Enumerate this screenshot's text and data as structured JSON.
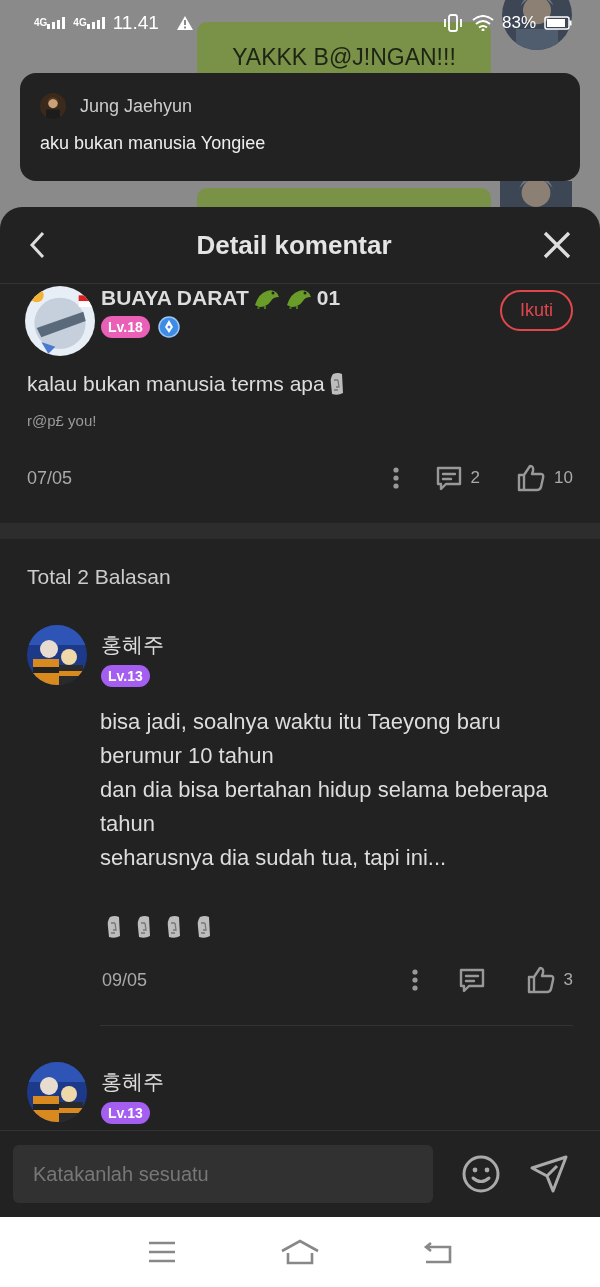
{
  "status_bar": {
    "network": [
      "4G",
      "4G"
    ],
    "time": "11.41",
    "battery": "83%"
  },
  "background_chat": {
    "message": "YAKKK B@J!NGAN!!!"
  },
  "notification": {
    "sender": "Jung Jaehyun",
    "message": "aku bukan manusia Yongiee"
  },
  "sheet": {
    "title": "Detail komentar"
  },
  "comment": {
    "author": "BUAYA DARAT",
    "author_suffix": "01",
    "level": {
      "text": "Lv.18",
      "color": "#e960b6"
    },
    "follow_button": "Ikuti",
    "text": "kalau bukan manusia terms apa",
    "signature": "r@p£ you!",
    "date": "07/05",
    "reply_count": "2",
    "like_count": "10"
  },
  "replies_header": "Total 2 Balasan",
  "replies": [
    {
      "author": "홍혜주",
      "level": {
        "text": "Lv.13",
        "color": "#a45ef0"
      },
      "text": "bisa jadi, soalnya waktu itu Taeyong baru berumur 10 tahun\ndan dia bisa bertahan hidup selama beberapa tahun\nseharusnya dia sudah tua, tapi ini...",
      "date": "09/05",
      "like_count": "3"
    },
    {
      "author": "홍혜주",
      "level": {
        "text": "Lv.13",
        "color": "#a45ef0"
      }
    }
  ],
  "composer": {
    "placeholder": "Katakanlah sesuatu"
  }
}
